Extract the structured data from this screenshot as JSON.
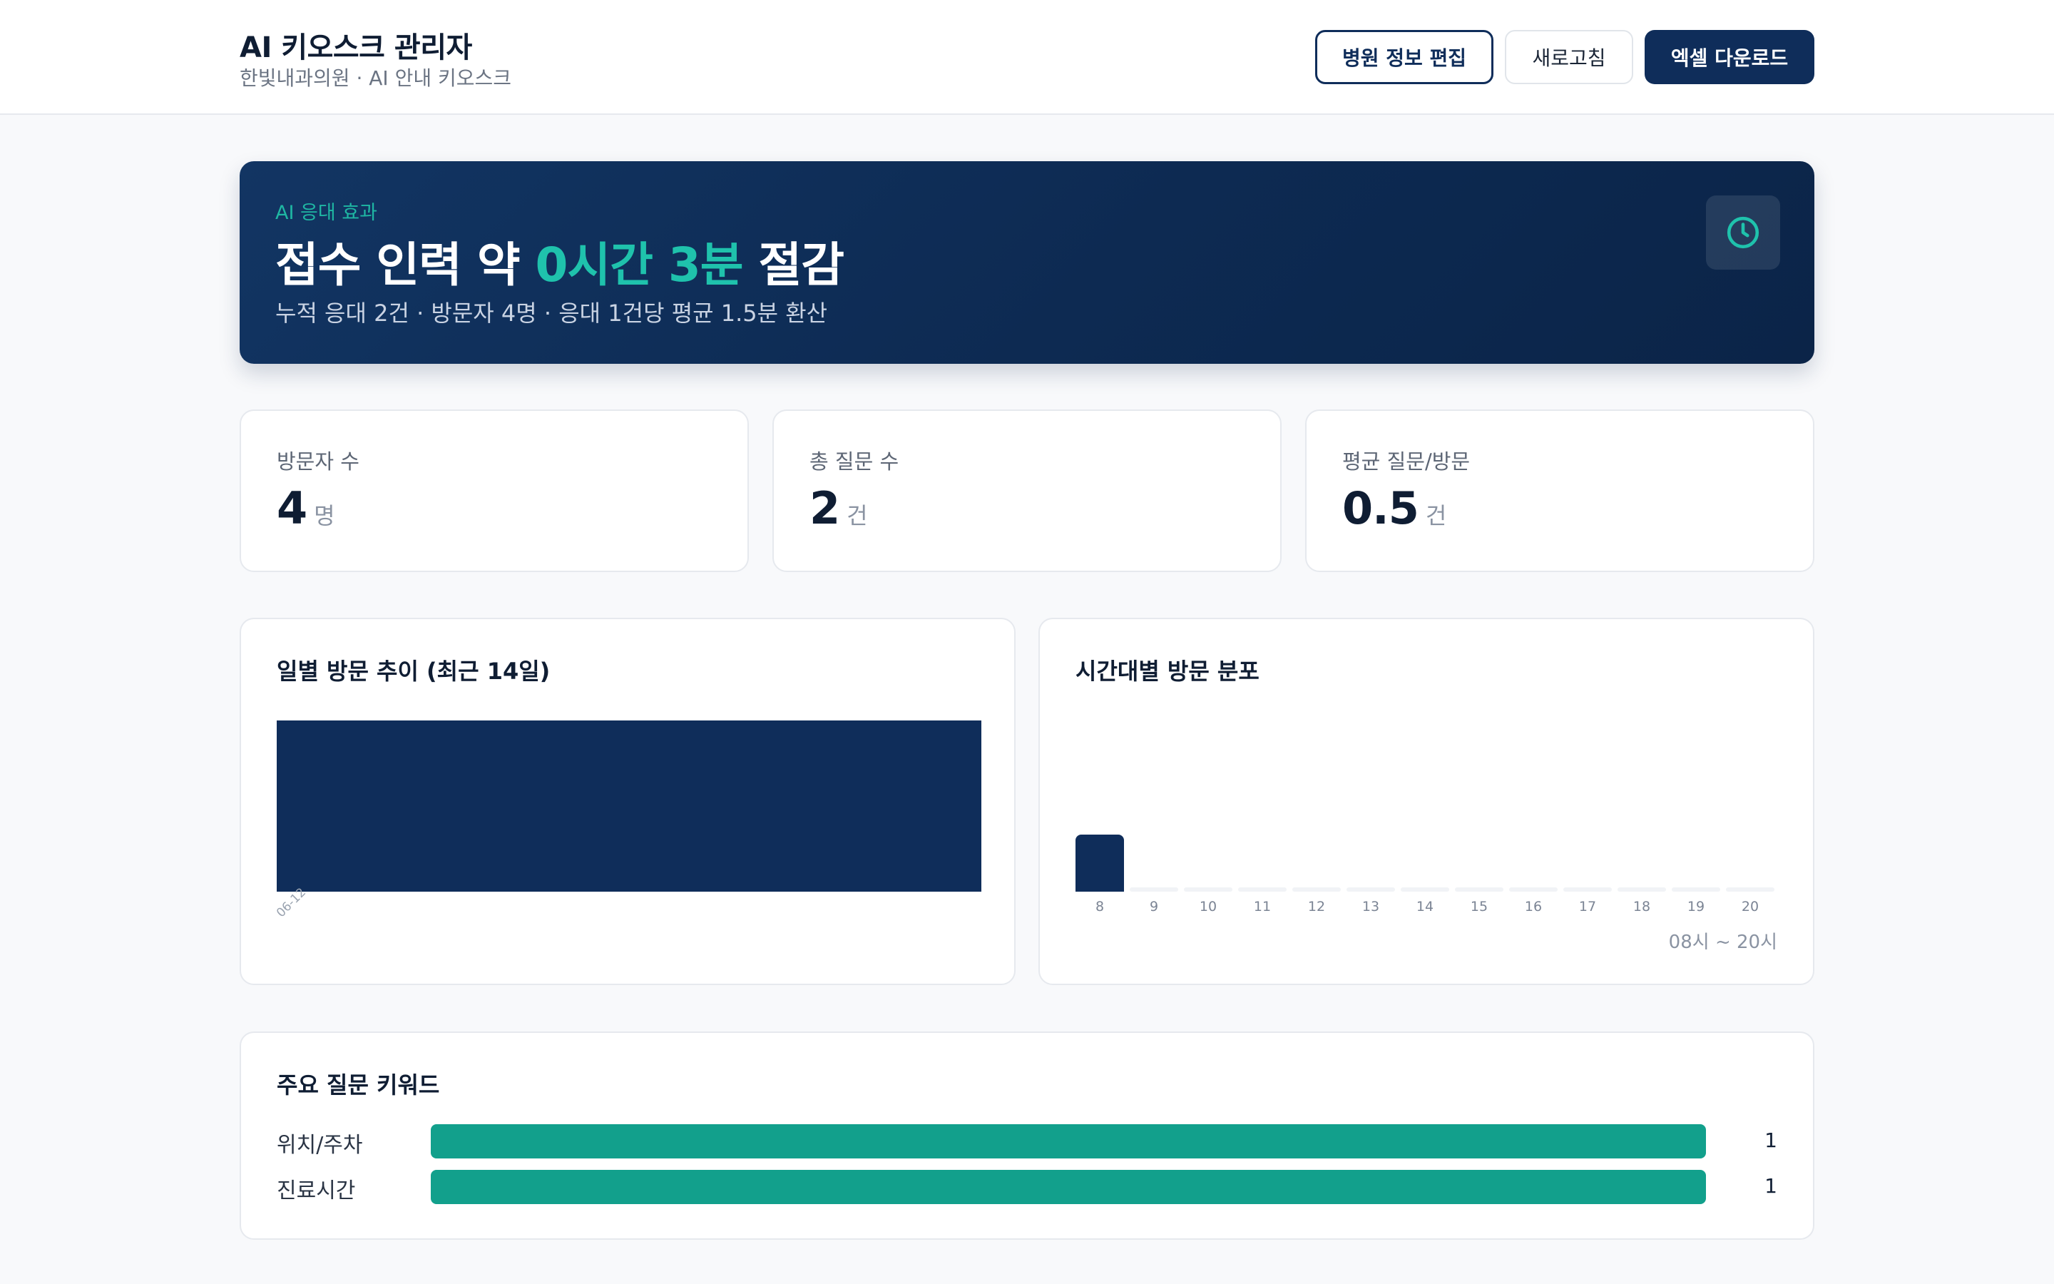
{
  "header": {
    "title": "AI 키오스크 관리자",
    "subtitle": "한빛내과의원 · AI 안내 키오스크",
    "edit_button": "병원 정보 편집",
    "refresh_button": "새로고침",
    "excel_button": "엑셀 다운로드"
  },
  "banner": {
    "tag": "AI 응대 효과",
    "headline_prefix": "접수 인력 약 ",
    "headline_highlight": "0시간 3분",
    "headline_suffix": " 절감",
    "description": "누적 응대 2건 · 방문자 4명 · 응대 1건당 평균 1.5분 환산",
    "icon": "clock-icon"
  },
  "stats": [
    {
      "label": "방문자 수",
      "value": "4",
      "unit": "명"
    },
    {
      "label": "총 질문 수",
      "value": "2",
      "unit": "건"
    },
    {
      "label": "평균 질문/방문",
      "value": "0.5",
      "unit": "건"
    }
  ],
  "daily_chart": {
    "title": "일별 방문 추이 (최근 14일)",
    "chart_data": {
      "type": "bar",
      "categories": [
        "06-12"
      ],
      "values": [
        4
      ]
    }
  },
  "hourly_chart": {
    "title": "시간대별 방문 분포",
    "range_label": "08시 ~ 20시",
    "chart_data": {
      "type": "bar",
      "categories": [
        "8",
        "9",
        "10",
        "11",
        "12",
        "13",
        "14",
        "15",
        "16",
        "17",
        "18",
        "19",
        "20"
      ],
      "values": [
        4,
        0,
        0,
        0,
        0,
        0,
        0,
        0,
        0,
        0,
        0,
        0,
        0
      ]
    }
  },
  "keywords": {
    "title": "주요 질문 키워드",
    "chart_data": {
      "type": "bar",
      "categories": [
        "위치/주차",
        "진료시간"
      ],
      "values": [
        1,
        1
      ]
    }
  },
  "colors": {
    "navy": "#0f2d5a",
    "teal": "#12a08c",
    "highlight": "#1fc2ac"
  }
}
